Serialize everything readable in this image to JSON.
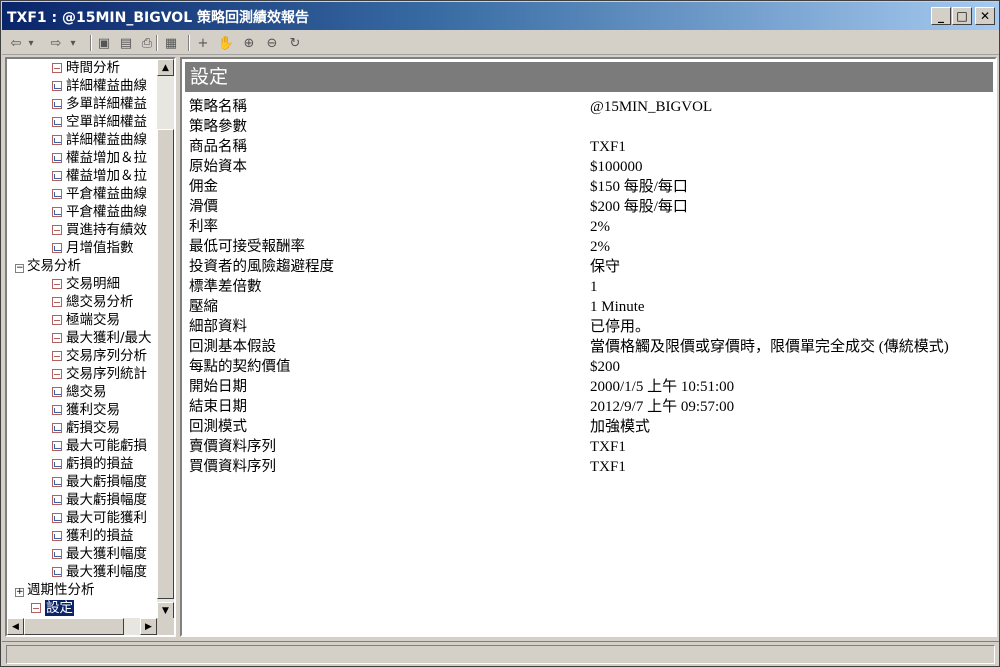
{
  "window": {
    "title": "TXF1 : @15MIN_BIGVOL 策略回測績效報告",
    "minimize": "_",
    "maximize": "□",
    "close": "✕"
  },
  "toolbar": {
    "buttons": [
      {
        "icon": "back-arrow-icon",
        "glyph": "⇦"
      },
      {
        "icon": "dropdown-icon",
        "glyph": "▾"
      },
      {
        "icon": "forward-arrow-icon",
        "glyph": "⇨"
      },
      {
        "icon": "dropdown-icon",
        "glyph": "▾"
      },
      {
        "icon": "save-icon",
        "glyph": "▣"
      },
      {
        "icon": "preview-icon",
        "glyph": "▤"
      },
      {
        "icon": "print-icon",
        "glyph": "⎙"
      },
      {
        "icon": "table-icon",
        "glyph": "▦"
      },
      {
        "icon": "crosshair-icon",
        "glyph": "+"
      },
      {
        "icon": "hand-icon",
        "glyph": "✋"
      },
      {
        "icon": "zoom-in-icon",
        "glyph": "⊕"
      },
      {
        "icon": "zoom-out-icon",
        "glyph": "⊖"
      },
      {
        "icon": "refresh-icon",
        "glyph": "↻"
      }
    ]
  },
  "tree": {
    "items": [
      {
        "label": "時間分析",
        "level": 2,
        "icon": "table"
      },
      {
        "label": "詳細權益曲線",
        "level": 2,
        "icon": "chart"
      },
      {
        "label": "多單詳細權益",
        "level": 2,
        "icon": "chart"
      },
      {
        "label": "空單詳細權益",
        "level": 2,
        "icon": "chart"
      },
      {
        "label": "詳細權益曲線",
        "level": 2,
        "icon": "chart"
      },
      {
        "label": "權益增加＆拉",
        "level": 2,
        "icon": "chart"
      },
      {
        "label": "權益增加＆拉",
        "level": 2,
        "icon": "chart"
      },
      {
        "label": "平倉權益曲線",
        "level": 2,
        "icon": "chart"
      },
      {
        "label": "平倉權益曲線",
        "level": 2,
        "icon": "chart"
      },
      {
        "label": "買進持有績效",
        "level": 2,
        "icon": "table"
      },
      {
        "label": "月增值指數",
        "level": 2,
        "icon": "chart"
      },
      {
        "label": "交易分析",
        "level": 1,
        "expander": "−"
      },
      {
        "label": "交易明細",
        "level": 2,
        "icon": "table"
      },
      {
        "label": "總交易分析",
        "level": 2,
        "icon": "table"
      },
      {
        "label": "極端交易",
        "level": 2,
        "icon": "table"
      },
      {
        "label": "最大獲利/最大",
        "level": 2,
        "icon": "table"
      },
      {
        "label": "交易序列分析",
        "level": 2,
        "icon": "table"
      },
      {
        "label": "交易序列統計",
        "level": 2,
        "icon": "table"
      },
      {
        "label": "總交易",
        "level": 2,
        "icon": "chart"
      },
      {
        "label": "獲利交易",
        "level": 2,
        "icon": "chart"
      },
      {
        "label": "虧損交易",
        "level": 2,
        "icon": "chart"
      },
      {
        "label": "最大可能虧損",
        "level": 2,
        "icon": "chart"
      },
      {
        "label": "虧損的損益",
        "level": 2,
        "icon": "chart"
      },
      {
        "label": "最大虧損幅度",
        "level": 2,
        "icon": "chart"
      },
      {
        "label": "最大虧損幅度",
        "level": 2,
        "icon": "chart"
      },
      {
        "label": "最大可能獲利",
        "level": 2,
        "icon": "chart"
      },
      {
        "label": "獲利的損益",
        "level": 2,
        "icon": "chart"
      },
      {
        "label": "最大獲利幅度",
        "level": 2,
        "icon": "chart"
      },
      {
        "label": "最大獲利幅度",
        "level": 2,
        "icon": "chart"
      },
      {
        "label": "週期性分析",
        "level": 1,
        "expander": "+"
      },
      {
        "label": "設定",
        "level": 1,
        "icon": "table",
        "selected": true
      }
    ]
  },
  "settings": {
    "header": "設定",
    "rows": [
      {
        "label": "策略名稱",
        "value": "@15MIN_BIGVOL"
      },
      {
        "label": "策略參數",
        "value": ""
      },
      {
        "label": "商品名稱",
        "value": "TXF1"
      },
      {
        "label": "原始資本",
        "value": "$100000"
      },
      {
        "label": "佣金",
        "value": "$150 每股/每口"
      },
      {
        "label": "滑價",
        "value": "$200 每股/每口"
      },
      {
        "label": "利率",
        "value": "2%"
      },
      {
        "label": "最低可接受報酬率",
        "value": "2%"
      },
      {
        "label": "投資者的風險趨避程度",
        "value": "保守"
      },
      {
        "label": "標準差倍數",
        "value": "1"
      },
      {
        "label": "壓縮",
        "value": "1 Minute"
      },
      {
        "label": "細部資料",
        "value": "已停用。"
      },
      {
        "label": "回測基本假設",
        "value": "當價格觸及限價或穿價時，限價單完全成交 (傳統模式)"
      },
      {
        "label": "每點的契約價值",
        "value": "$200"
      },
      {
        "label": "開始日期",
        "value": "2000/1/5 上午 10:51:00"
      },
      {
        "label": "結束日期",
        "value": "2012/9/7 上午 09:57:00"
      },
      {
        "label": "回測模式",
        "value": "加強模式"
      },
      {
        "label": "賣價資料序列",
        "value": "TXF1"
      },
      {
        "label": "買價資料序列",
        "value": "TXF1"
      }
    ]
  }
}
